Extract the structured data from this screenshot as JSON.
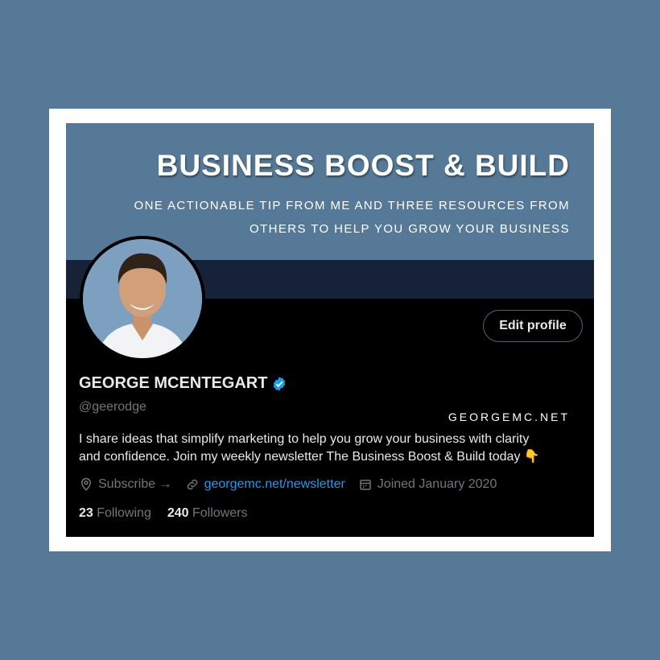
{
  "banner": {
    "title": "BUSINESS BOOST & BUILD",
    "subtitle_line1": "ONE ACTIONABLE TIP FROM ME AND THREE RESOURCES FROM",
    "subtitle_line2": "OTHERS TO HELP YOU GROW YOUR BUSINESS",
    "website": "GEORGEMC.NET"
  },
  "profile": {
    "name": "GEORGE MCENTEGART",
    "handle": "@geerodge",
    "bio_line1": "I share ideas that simplify marketing to help you grow your business with clarity",
    "bio_line2": "and confidence. Join my weekly newsletter The Business Boost & Build today 👇",
    "edit_label": "Edit profile",
    "location": "Subscribe →",
    "link": "georgemc.net/newsletter",
    "joined": "Joined January 2020"
  },
  "stats": {
    "following_count": "23",
    "following_label": "Following",
    "followers_count": "240",
    "followers_label": "Followers"
  },
  "colors": {
    "page_background": "#557996",
    "banner_background": "#557996",
    "banner_strip": "#152238",
    "profile_background": "#000000",
    "link": "#1d9bf0",
    "verified": "#1d9bf0"
  },
  "icons": {
    "verified": "verified-badge-icon",
    "location": "location-pin-icon",
    "link": "link-icon",
    "calendar": "calendar-icon"
  }
}
